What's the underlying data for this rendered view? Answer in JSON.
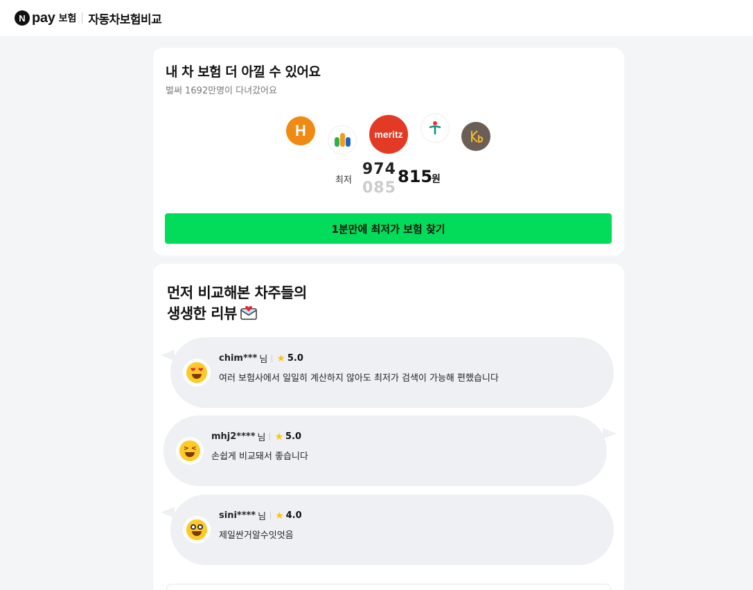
{
  "header": {
    "logo_letter": "N",
    "brand": "pay",
    "brand_sub": "보험",
    "title": "자동차보험비교"
  },
  "hero": {
    "title": "내 차 보험 더 아낄 수 있어요",
    "subtitle": "벌써 1692만명이 다녀갔어요",
    "insurers": [
      {
        "name": "hyundai-logo",
        "mark": "H",
        "color": "#f08a12"
      },
      {
        "name": "db-logo",
        "mark": "",
        "color": "#ffffff"
      },
      {
        "name": "meritz-logo",
        "mark": "meritz",
        "color": "#e23a24"
      },
      {
        "name": "hana-logo",
        "mark": "†",
        "color": "#ffffff"
      },
      {
        "name": "kb-logo",
        "mark": "★b",
        "color": "#6b5e55"
      }
    ],
    "price_label": "최저",
    "price_roll_top": "974",
    "price_roll_bottom": "085",
    "price_main": "815",
    "price_unit": "원",
    "cta_label": "1분만에 최저가 보험 찾기",
    "accent_color": "#03db5a"
  },
  "reviews": {
    "title_line1": "먼저 비교해본 차주들의",
    "title_line2": "생생한 리뷰",
    "items": [
      {
        "user": "chim***",
        "honorific": "님",
        "score": "5.0",
        "text": "여러 보험사에서 일일히 계산하지 않아도 최저가 검색이 가능해 편했습니다",
        "emoji": "heart-eyes-emoji"
      },
      {
        "user": "mhj2****",
        "honorific": "님",
        "score": "5.0",
        "text": "손쉽게 비교돼서 좋습니다",
        "emoji": "squint-laugh-emoji"
      },
      {
        "user": "sini****",
        "honorific": "님",
        "score": "4.0",
        "text": "제일싼거알수잇엇음",
        "emoji": "grin-emoji"
      }
    ]
  }
}
